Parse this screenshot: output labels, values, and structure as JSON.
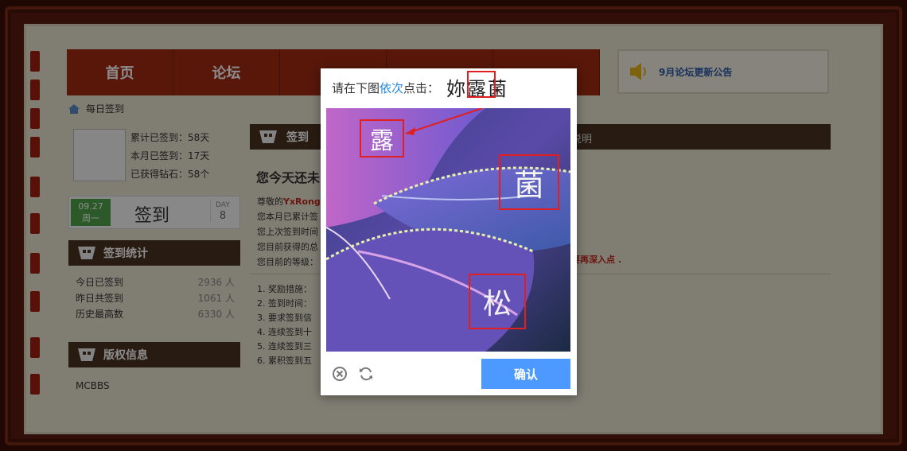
{
  "nav": {
    "items": [
      "首页",
      "论坛",
      "",
      "",
      "",
      ""
    ]
  },
  "notice": {
    "text": "9月论坛更新公告"
  },
  "breadcrumb": {
    "label": "每日签到"
  },
  "user_stats": [
    "累计已签到：58天",
    "本月已签到：17天",
    "已获得钻石：58个"
  ],
  "sign": {
    "date": "09.27",
    "weekday": "周一",
    "label": "签到",
    "day_label": "DAY",
    "day_num": "8"
  },
  "stats_section": {
    "title": "签到统计",
    "rows": [
      {
        "label": "今日已签到",
        "value": "2936 人"
      },
      {
        "label": "昨日共签到",
        "value": "1061 人"
      },
      {
        "label": "历史最高数",
        "value": "6330 人"
      }
    ]
  },
  "copyright_section": {
    "title": "版权信息",
    "text": "MCBBS"
  },
  "main": {
    "tab": "签到",
    "right_label": "说明",
    "title": "您今天还未",
    "greeting_prefix": "尊敬的",
    "username": "YxRong",
    "lines": [
      "您本月已累计签",
      "您上次签到时间",
      "您目前获得的总",
      "您目前的等级："
    ],
    "deep_text": "要再深入点 .",
    "rules": [
      "1. 奖励措施：",
      "2. 签到时间：",
      "3. 要求签到信",
      "4. 连续签到十",
      "5. 连续签到三",
      "6. 累积签到五"
    ]
  },
  "captcha": {
    "prompt_before": "请在下图",
    "prompt_highlight": "依次",
    "prompt_after": "点击：",
    "target_chars": "妳露菌",
    "image_chars": [
      "露",
      "菌",
      "松"
    ],
    "confirm_label": "确认",
    "colors": {
      "accent": "#4c9aff",
      "highlight": "#e02020"
    }
  }
}
